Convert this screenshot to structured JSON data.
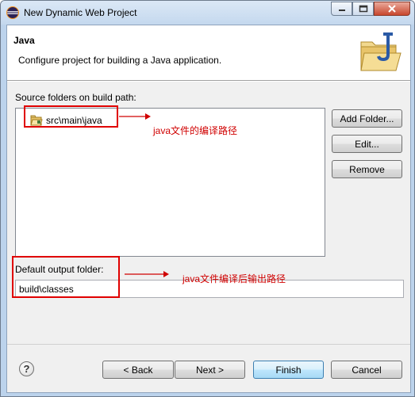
{
  "window": {
    "title": "New Dynamic Web Project"
  },
  "banner": {
    "title": "Java",
    "description": "Configure project for building a Java application.",
    "image_icon": "java-folder-wizard-icon"
  },
  "source": {
    "label": "Source folders on build path:",
    "items": [
      {
        "label": "src\\main\\java",
        "icon": "source-folder-icon"
      }
    ],
    "buttons": {
      "add_folder": "Add Folder...",
      "edit": "Edit...",
      "remove": "Remove"
    }
  },
  "output": {
    "label": "Default output folder:",
    "value": "build\\classes"
  },
  "annotations": {
    "source_note": "java文件的编译路径",
    "output_note": "java文件编译后输出路径",
    "color": "#d00000"
  },
  "footer": {
    "help_icon": "help-icon",
    "back": "< Back",
    "next": "Next >",
    "finish": "Finish",
    "cancel": "Cancel"
  }
}
